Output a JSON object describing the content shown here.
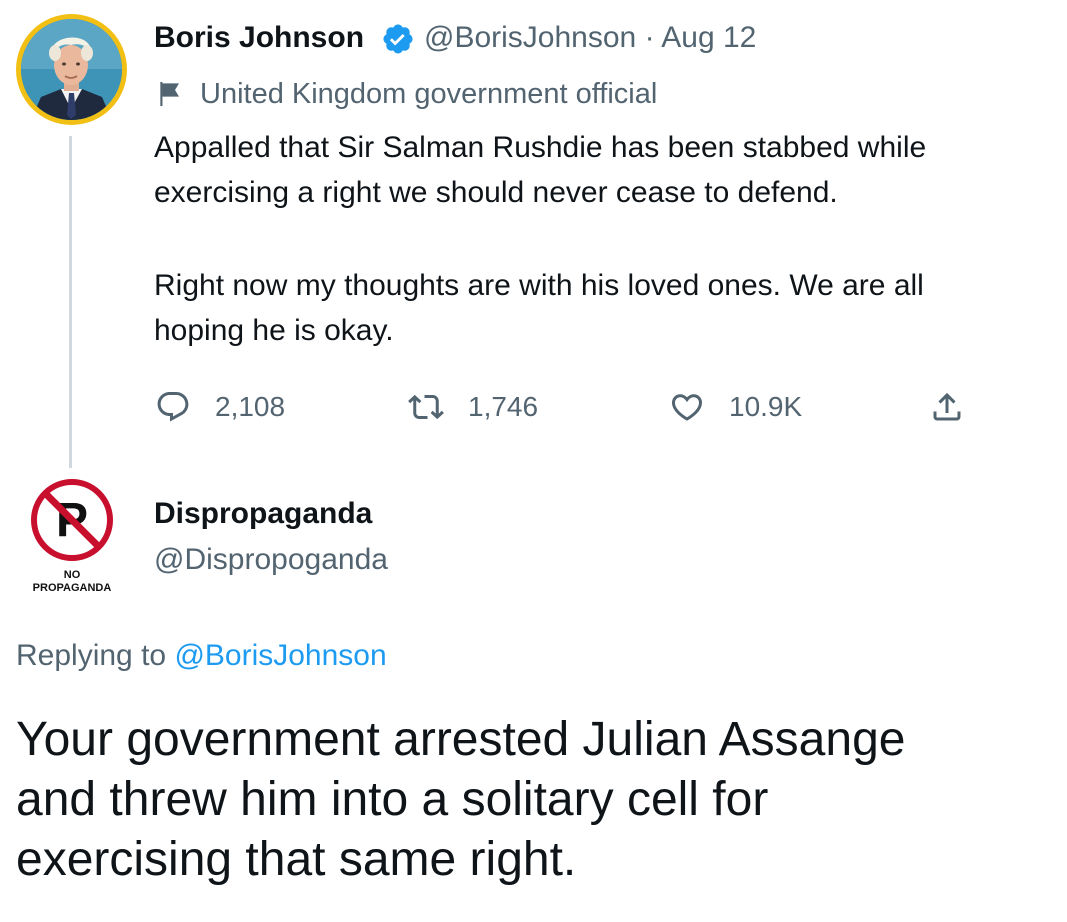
{
  "original_tweet": {
    "author_name": "Boris Johnson",
    "verified": true,
    "handle": "@BorisJohnson",
    "separator": "·",
    "date": "Aug 12",
    "label": "United Kingdom government official",
    "text_paragraph_1_line_1": "Appalled that Sir Salman Rushdie has been stabbed while",
    "text_paragraph_1_line_2": "exercising a right we should never cease to defend.",
    "text_paragraph_2_line_1": "Right now my thoughts are with his loved ones. We are all",
    "text_paragraph_2_line_2": "hoping he is okay.",
    "actions": {
      "reply_count": "2,108",
      "retweet_count": "1,746",
      "like_count": "10.9K"
    },
    "avatar_ring_color": "#f2c014"
  },
  "reply_tweet": {
    "author_name": "Dispropaganda",
    "handle": "@Dispropoganda",
    "avatar_logo_text_line_1": "NO",
    "avatar_logo_text_line_2": "PROPAGANDA",
    "replying_prefix": "Replying to",
    "replying_to": "@BorisJohnson",
    "text_line_1": "Your government arrested Julian Assange",
    "text_line_2": "and threw him into a solitary cell for",
    "text_line_3": "exercising that same right."
  },
  "colors": {
    "text_primary": "#0f1419",
    "text_secondary": "#536471",
    "link": "#1d9bf0",
    "verified_badge": "#1d9bf0",
    "thread_line": "#cfd9de",
    "no_sign_red": "#c8102e"
  }
}
